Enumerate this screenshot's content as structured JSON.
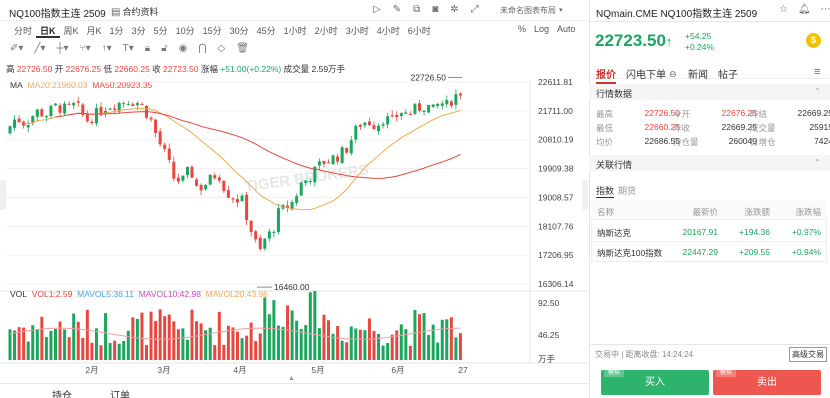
{
  "header": {
    "title": "NQ100指数主连 2509",
    "contract_info": "合约资料",
    "layout_label": "未命名图表布局",
    "periods": [
      "分时",
      "日K",
      "周K",
      "月K",
      "1分",
      "3分",
      "5分",
      "10分",
      "15分",
      "30分",
      "45分",
      "1小时",
      "2小时",
      "3小时",
      "4小时",
      "6小时"
    ],
    "active_period": "日K",
    "right_controls": [
      "%",
      "Log",
      "Auto"
    ]
  },
  "ohlc": {
    "high_label": "高",
    "high": "22726.50",
    "open_label": "开",
    "open": "22676.25",
    "low_label": "低",
    "low": "22660.25",
    "close_label": "收",
    "close": "22723.50",
    "change_label": "涨幅",
    "change": "+51.00(+0.22%)",
    "volume_label": "成交量",
    "volume": "2.59万手"
  },
  "ma": {
    "label": "MA",
    "ma20": "MA20:21960.03",
    "ma50": "MA50:20923.35",
    "color_ma20": "#f0a94c",
    "color_ma50": "#e8473f"
  },
  "vol": {
    "label": "VOL",
    "vol1": "VOL1:2.59",
    "mavol5": "MAVOL5:36.11",
    "mavol10": "MAVOL10:42.98",
    "mavol20": "MAVOL20:43.96"
  },
  "price_axis": [
    "22611.81",
    "21711.00",
    "20810.19",
    "19909.38",
    "19008.57",
    "18107.76",
    "17206.95",
    "16306.14"
  ],
  "vol_axis": [
    "92.50",
    "46.25",
    "万手"
  ],
  "x_labels": [
    "2月",
    "3月",
    "4月",
    "5月",
    "6月",
    "27"
  ],
  "annotations": {
    "high_marker": "22726.50",
    "low_marker": "16460.00",
    "watermark": "TIGER BROKERS"
  },
  "bottom_tabs": [
    "持仓",
    "订单"
  ],
  "quote": {
    "name": "NQmain.CME NQ100指数主连 2509",
    "price": "22723.50",
    "arrow": "↑",
    "change": "+54.25",
    "change_pct": "+0.24%",
    "tabs": [
      "报价",
      "闪电下单",
      "新闻",
      "帖子"
    ],
    "active_tab": "报价",
    "data_title": "行情数据",
    "fields": [
      {
        "label": "最高",
        "value": "22726.50",
        "label2": "今开",
        "value2": "22676.25",
        "label3": "昨结",
        "value3": "22669.25",
        "c1": "up",
        "c2": "up",
        "c3": "flat"
      },
      {
        "label": "最低",
        "value": "22660.25",
        "label2": "昨收",
        "value2": "22669.25",
        "label3": "成交量",
        "value3": "25915",
        "c1": "up",
        "c2": "flat",
        "c3": "flat"
      },
      {
        "label": "均价",
        "value": "22686.55",
        "label2": "持仓量",
        "value2": "260049",
        "label3": "日增仓",
        "value3": "7424",
        "c1": "flat",
        "c2": "flat",
        "c3": "flat"
      }
    ],
    "related_title": "关联行情",
    "related_tabs": [
      "指数",
      "期货"
    ],
    "table_headers": [
      "名称",
      "最新价",
      "涨跌额",
      "涨跌幅"
    ],
    "table_rows": [
      [
        "纳斯达克",
        "20167.91",
        "+194.36",
        "+0.97%"
      ],
      [
        "纳斯达克100指数",
        "22447.29",
        "+209.55",
        "+0.94%"
      ]
    ],
    "status": "交易中 | 距离收盘: 14:24:24",
    "advanced_order": "高级交易",
    "buy_tag": "模拟",
    "buy_label": "买入",
    "sell_tag": "模拟",
    "sell_label": "卖出"
  },
  "colors": {
    "up": "#e8473f",
    "down": "#1aa65c",
    "price_green": "#1aa65c"
  }
}
